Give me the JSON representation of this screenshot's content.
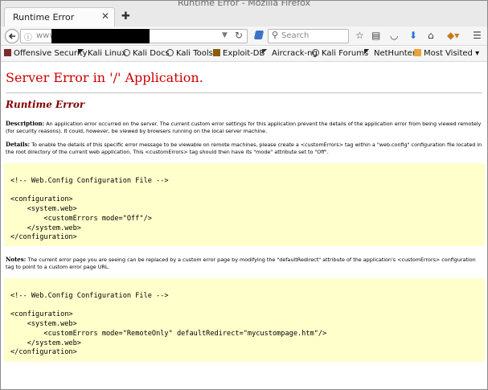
{
  "window": {
    "title": "Runtime Error - Mozilla Firefox"
  },
  "tab": {
    "label": "Runtime Error",
    "close_glyph": "✕",
    "new_tab_glyph": "✚"
  },
  "navbar": {
    "url_prefix": "www",
    "search_placeholder": "Search"
  },
  "bookmarks": [
    {
      "label": "Offensive Security",
      "icon": "offsec-icon",
      "color": "#7a2b2b"
    },
    {
      "label": "Kali Linux",
      "icon": "kali-dragon-icon",
      "color": "#222222"
    },
    {
      "label": "Kali Docs",
      "icon": "kali-docs-icon",
      "color": "#444444"
    },
    {
      "label": "Kali Tools",
      "icon": "kali-tools-icon",
      "color": "#444444"
    },
    {
      "label": "Exploit-DB",
      "icon": "exploitdb-icon",
      "color": "#8a5a00"
    },
    {
      "label": "Aircrack-ng",
      "icon": "aircrack-icon",
      "color": "#333333"
    },
    {
      "label": "Kali Forums",
      "icon": "kali-forums-icon",
      "color": "#444444"
    },
    {
      "label": "NetHunter",
      "icon": "nethunter-icon",
      "color": "#222222"
    },
    {
      "label": "Most Visited",
      "icon": "folder-icon",
      "color": "#e8a33a",
      "has_dropdown": true
    }
  ],
  "page": {
    "title": "Server Error in '/' Application.",
    "subtitle": "Runtime Error",
    "description_label": "Description:",
    "description_text": "An application error occurred on the server. The current custom error settings for this application prevent the details of the application error from being viewed remotely (for security reasons). It could, however, be viewed by browsers running on the local server machine.",
    "details_label": "Details:",
    "details_text": "To enable the details of this specific error message to be viewable on remote machines, please create a <customErrors> tag within a \"web.config\" configuration file located in the root directory of the current web application. This <customErrors> tag should then have its \"mode\" attribute set to \"Off\".",
    "code1": "<!-- Web.Config Configuration File -->\n\n<configuration>\n    <system.web>\n        <customErrors mode=\"Off\"/>\n    </system.web>\n</configuration>",
    "notes_label": "Notes:",
    "notes_text": "The current error page you are seeing can be replaced by a custom error page by modifying the \"defaultRedirect\" attribute of the application's <customErrors> configuration tag to point to a custom error page URL.",
    "code2": "<!-- Web.Config Configuration File -->\n\n<configuration>\n    <system.web>\n        <customErrors mode=\"RemoteOnly\" defaultRedirect=\"mycustompage.htm\"/>\n    </system.web>\n</configuration>",
    "colors": {
      "title": "#cc0000",
      "subtitle": "#800000",
      "code_bg": "#ffffcc"
    }
  }
}
